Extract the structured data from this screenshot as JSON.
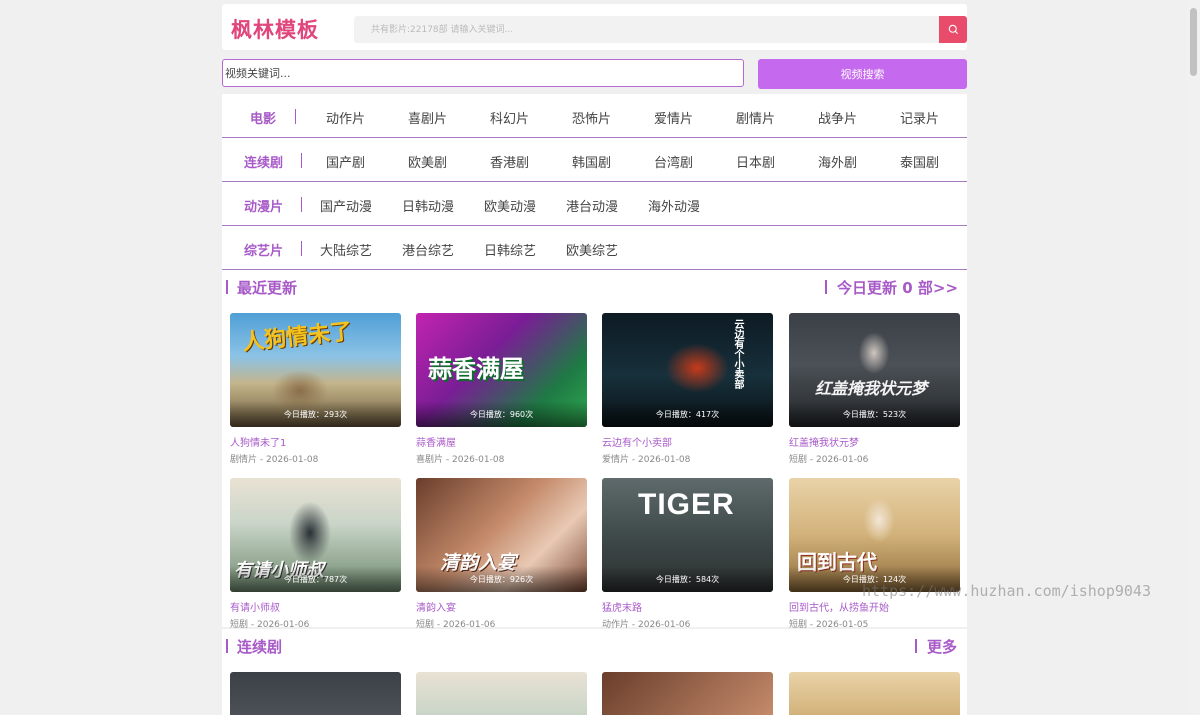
{
  "header": {
    "logo": "枫林模板",
    "search_placeholder": "共有影片:22178部 请输入关键词..."
  },
  "video_search": {
    "placeholder": "视频关键词...",
    "button": "视频搜索"
  },
  "nav": [
    {
      "title": "电影",
      "items": [
        "动作片",
        "喜剧片",
        "科幻片",
        "恐怖片",
        "爱情片",
        "剧情片",
        "战争片",
        "记录片"
      ]
    },
    {
      "title": "连续剧",
      "items": [
        "国产剧",
        "欧美剧",
        "香港剧",
        "韩国剧",
        "台湾剧",
        "日本剧",
        "海外剧",
        "泰国剧"
      ]
    },
    {
      "title": "动漫片",
      "items": [
        "国产动漫",
        "日韩动漫",
        "欧美动漫",
        "港台动漫",
        "海外动漫"
      ]
    },
    {
      "title": "综艺片",
      "items": [
        "大陆综艺",
        "港台综艺",
        "日韩综艺",
        "欧美综艺"
      ]
    }
  ],
  "latest": {
    "title": "最近更新",
    "more": "今日更新 0 部>>",
    "plays_prefix": "今日播放：",
    "cards": [
      {
        "title": "人狗情未了1",
        "category": "剧情片",
        "date": "2026-01-08",
        "plays": "293次",
        "poster": "人狗情未了"
      },
      {
        "title": "蒜香满屋",
        "category": "喜剧片",
        "date": "2026-01-08",
        "plays": "960次",
        "poster": "蒜香满屋"
      },
      {
        "title": "云边有个小卖部",
        "category": "爱情片",
        "date": "2026-01-08",
        "plays": "417次",
        "poster": "云边有个小卖部"
      },
      {
        "title": "红盖掩我状元梦",
        "category": "短剧",
        "date": "2026-01-06",
        "plays": "523次",
        "poster": "红盖掩我状元梦"
      },
      {
        "title": "有请小师叔",
        "category": "短剧",
        "date": "2026-01-06",
        "plays": "787次",
        "poster": "有请小师叔"
      },
      {
        "title": "清韵入宴",
        "category": "短剧",
        "date": "2026-01-06",
        "plays": "926次",
        "poster": "清韵入宴"
      },
      {
        "title": "猛虎末路",
        "category": "动作片",
        "date": "2026-01-06",
        "plays": "584次",
        "poster": "TIGER"
      },
      {
        "title": "回到古代，从捞鱼开始",
        "category": "短剧",
        "date": "2026-01-05",
        "plays": "124次",
        "poster": "回到古代"
      }
    ]
  },
  "series": {
    "title": "连续剧",
    "more": "更多"
  },
  "watermark": "https://www.huzhan.com/ishop9043",
  "colors": {
    "accent": "#a85ac8",
    "brand": "#e0457b",
    "search_button": "#e84c6a",
    "video_button": "#c569ee"
  }
}
